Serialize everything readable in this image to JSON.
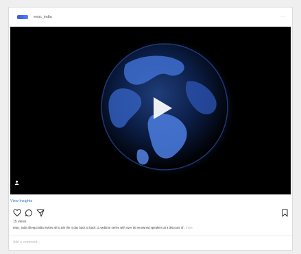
{
  "post": {
    "username": "eepc_india",
    "more_label": "···",
    "view_insights": "View Insights",
    "views": "15 views",
    "caption_user": "eepc_india",
    "caption_text": " @eepcindia invites all to join the 4 day back to back 11 webinar series with over 50 renowned speakers at a discount of..",
    "caption_more": " more",
    "comment_placeholder": "Add a comment..."
  },
  "icons": {
    "brand_logo": "eepc-logo",
    "more": "ellipsis-icon",
    "play": "play-icon",
    "user_tag": "user-icon",
    "like": "heart-icon",
    "comment": "comment-icon",
    "share": "send-icon",
    "save": "bookmark-icon"
  },
  "colors": {
    "link": "#3a76c4",
    "media_background": "#000000",
    "globe_glow": "#4a7bd8"
  }
}
